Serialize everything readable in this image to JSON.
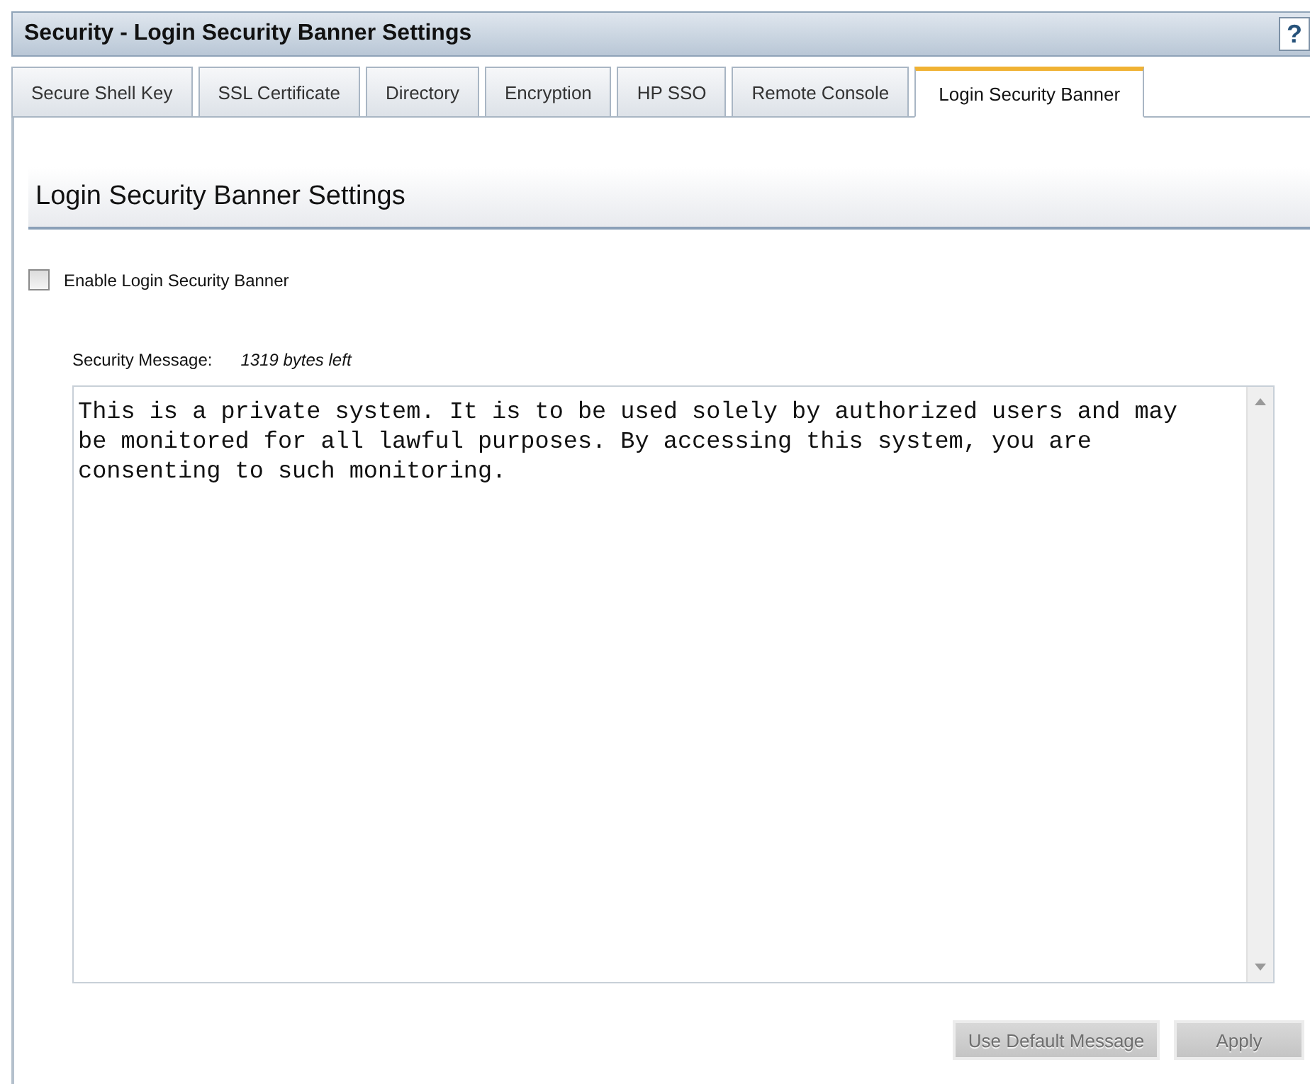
{
  "window": {
    "title": "Security - Login Security Banner Settings",
    "help": "?"
  },
  "tabs": [
    {
      "label": "Secure Shell Key",
      "selected": false
    },
    {
      "label": "SSL Certificate",
      "selected": false
    },
    {
      "label": "Directory",
      "selected": false
    },
    {
      "label": "Encryption",
      "selected": false
    },
    {
      "label": "HP SSO",
      "selected": false
    },
    {
      "label": "Remote Console",
      "selected": false
    },
    {
      "label": "Login Security Banner",
      "selected": true
    }
  ],
  "section": {
    "title": "Login Security Banner Settings"
  },
  "enable_banner": {
    "label": "Enable Login Security Banner",
    "checked": false
  },
  "message": {
    "label": "Security Message:",
    "remaining": "1319 bytes left",
    "value": "This is a private system. It is to be used solely by authorized users and may be monitored for all lawful purposes. By accessing this system, you are consenting to such monitoring."
  },
  "buttons": [
    {
      "label": "Use Default Message",
      "disabled": true
    },
    {
      "label": "Apply",
      "disabled": true
    }
  ]
}
